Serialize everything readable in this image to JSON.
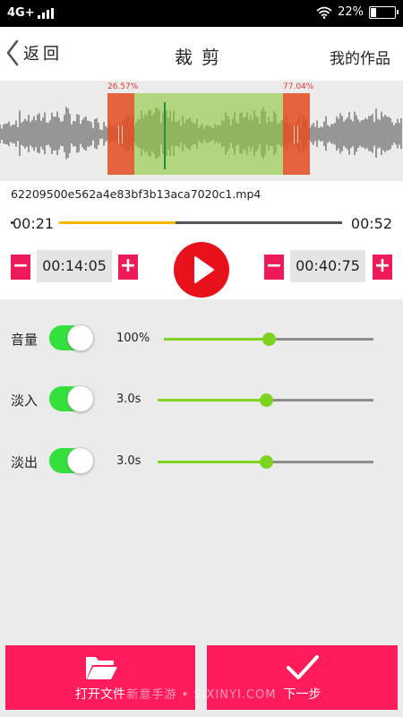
{
  "status_bar": {
    "network": "4G+",
    "battery_percent": "22%",
    "battery_level": 0.22,
    "icons": [
      "signal-icon",
      "wifi-icon",
      "battery-icon"
    ]
  },
  "header": {
    "back_label": "返回",
    "title": "裁剪",
    "works_label": "我的作品"
  },
  "waveform": {
    "start_percent": "26.57%",
    "end_percent": "77.04%",
    "start_fraction": 0.2657,
    "end_fraction": 0.7704,
    "playhead_fraction": 0.405
  },
  "file": {
    "name": "62209500e562a4e83bf3b13aca7020c1.mp4"
  },
  "timeline": {
    "current": "00:21",
    "total": "00:52",
    "progress": 0.41
  },
  "controls": {
    "start_time": "00:14:05",
    "end_time": "00:40:75",
    "minus": "−",
    "plus": "+"
  },
  "settings": {
    "volume": {
      "label": "音量",
      "enabled": true,
      "value": "100%",
      "level": 0.5
    },
    "fade_in": {
      "label": "淡入",
      "enabled": true,
      "value": "3.0s",
      "level": 0.5
    },
    "fade_out": {
      "label": "淡出",
      "enabled": true,
      "value": "3.0s",
      "level": 0.5
    }
  },
  "bottom": {
    "open_label": "打开文件",
    "next_label": "下一步",
    "watermark": "新意手游 • SIXINYI.COM"
  },
  "colors": {
    "accent": "#ff1b5c",
    "play": "#e8101a",
    "toggle_on": "#33e03c",
    "slider": "#7ed321",
    "progress": "#f7b500",
    "selection": "#8cc83c",
    "handle": "#e15023"
  }
}
